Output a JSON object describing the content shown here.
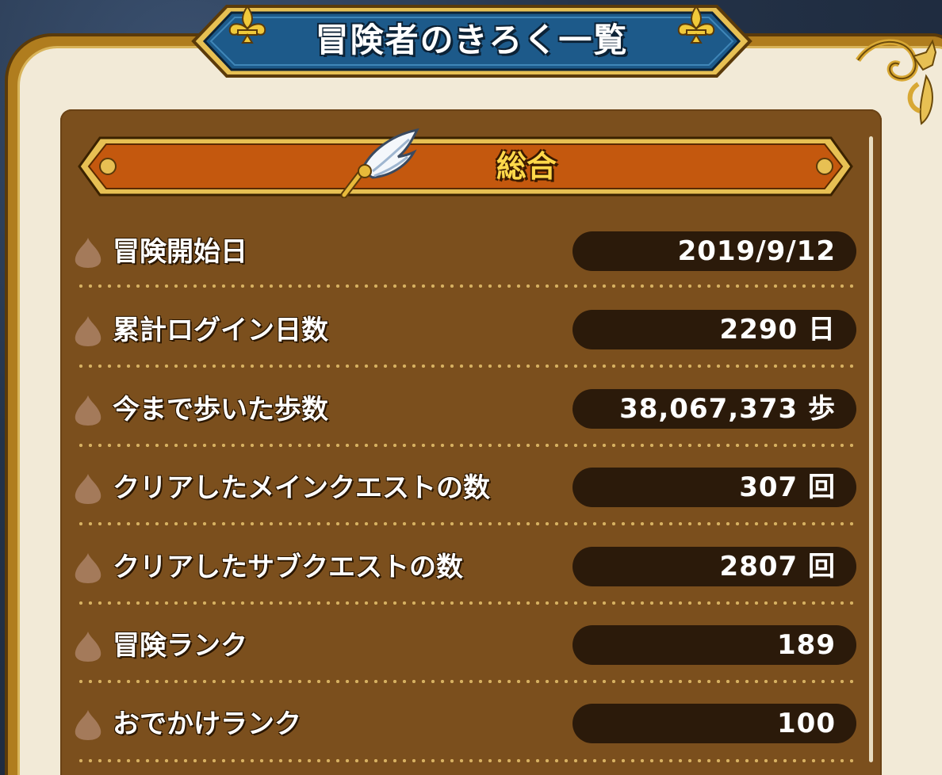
{
  "window": {
    "title": "冒険者のきろく一覧"
  },
  "section": {
    "title": "総合",
    "icon": "winged-quill-icon"
  },
  "records": [
    {
      "label": "冒険開始日",
      "value": "2019/9/12"
    },
    {
      "label": "累計ログイン日数",
      "value": "2290 日"
    },
    {
      "label": "今まで歩いた歩数",
      "value": "38,067,373 歩"
    },
    {
      "label": "クリアしたメインクエストの数",
      "value": "307 回"
    },
    {
      "label": "クリアしたサブクエストの数",
      "value": "2807 回"
    },
    {
      "label": "冒険ランク",
      "value": "189"
    },
    {
      "label": "おでかけランク",
      "value": "100"
    }
  ],
  "colors": {
    "panel": "#7b4f1d",
    "header_band": "#c4580e",
    "title_band": "#1d5a8a",
    "gold": "#d8a834",
    "value_box": "#2b1a0a"
  }
}
